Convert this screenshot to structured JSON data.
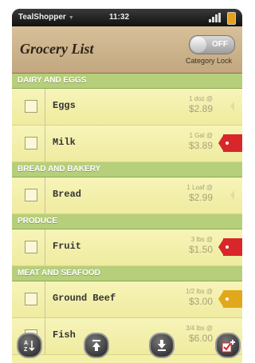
{
  "status_bar": {
    "app_name": "TealShopper",
    "time": "11:32"
  },
  "header": {
    "title": "Grocery List",
    "toggle_label": "OFF",
    "toggle_caption": "Category Lock"
  },
  "sections": [
    {
      "name": "DAIRY AND EGGS",
      "items": [
        {
          "name": "Eggs",
          "qty": "1 doz @",
          "price": "$2.89",
          "tag": "none"
        },
        {
          "name": "Milk",
          "qty": "1 Gal @",
          "price": "$3.89",
          "tag": "red"
        }
      ]
    },
    {
      "name": "BREAD AND BAKERY",
      "items": [
        {
          "name": "Bread",
          "qty": "1 Loaf @",
          "price": "$2.99",
          "tag": "none"
        }
      ]
    },
    {
      "name": "PRODUCE",
      "items": [
        {
          "name": "Fruit",
          "qty": "3 lbs @",
          "price": "$1.50",
          "tag": "red"
        }
      ]
    },
    {
      "name": "MEAT AND SEAFOOD",
      "items": [
        {
          "name": "Ground Beef",
          "qty": "1/2 lbs @",
          "price": "$3.00",
          "tag": "yellow"
        },
        {
          "name": "Fish",
          "qty": "3/4 lbs @",
          "price": "$6.00",
          "tag": "none"
        }
      ]
    }
  ],
  "colors": {
    "red_tag": "#d8262a",
    "yellow_tag": "#e2a81c",
    "section_bg": "#b6cf7a",
    "row_bg": "#f3f0a8"
  },
  "toolbar": {
    "icons": [
      "sort-az-icon",
      "scroll-top-icon",
      "scroll-bottom-icon",
      "add-checked-item-icon"
    ]
  }
}
